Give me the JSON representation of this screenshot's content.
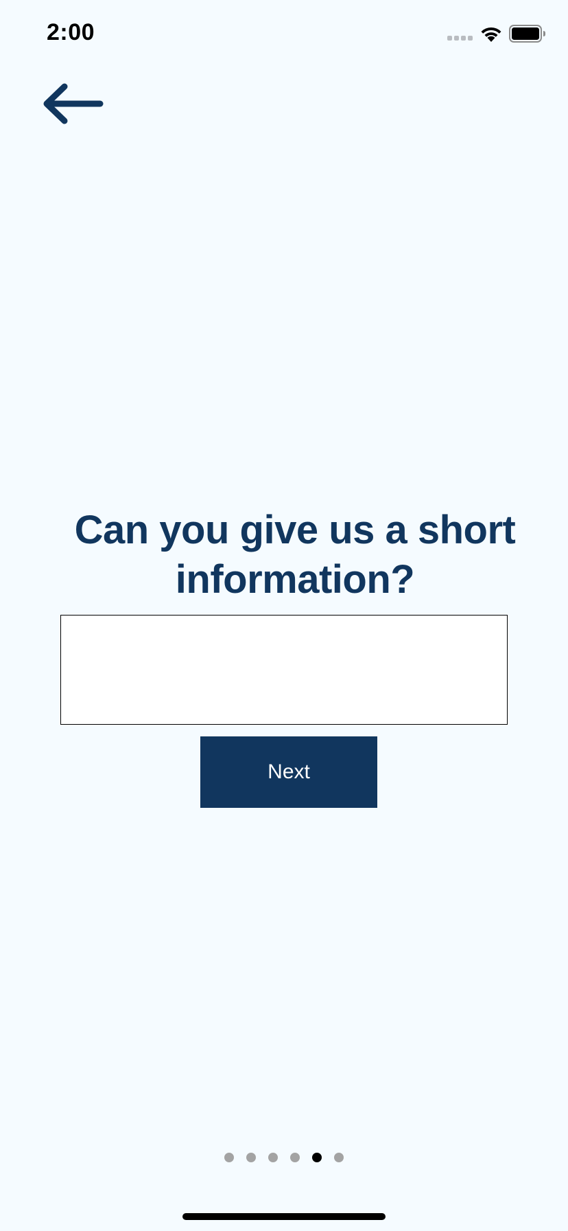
{
  "status_bar": {
    "time": "2:00"
  },
  "icons": {
    "back": "arrow-left-icon",
    "signal": "cellular-signal-icon",
    "wifi": "wifi-icon",
    "battery": "battery-icon"
  },
  "question": {
    "title": "Can you give us a short information?"
  },
  "input": {
    "value": "",
    "placeholder": ""
  },
  "actions": {
    "next_label": "Next"
  },
  "pagination": {
    "total": 6,
    "current": 5
  },
  "colors": {
    "background": "#f5fbff",
    "primary": "#11365e",
    "dot_inactive": "#a3a3a3",
    "dot_active": "#000000"
  }
}
